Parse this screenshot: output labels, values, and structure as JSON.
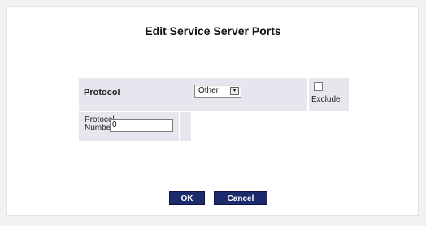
{
  "page": {
    "title": "Edit Service Server Ports"
  },
  "protocol": {
    "label": "Protocol",
    "selected": "Other",
    "exclude_label": "Exclude",
    "exclude_checked": false
  },
  "protocol_number": {
    "label_line1": "Protocol",
    "label_line2": "Number:",
    "value": "0"
  },
  "buttons": {
    "ok": "OK",
    "cancel": "Cancel"
  },
  "colors": {
    "button_bg": "#1d2a6b",
    "row_bg": "#e6e7ee"
  }
}
